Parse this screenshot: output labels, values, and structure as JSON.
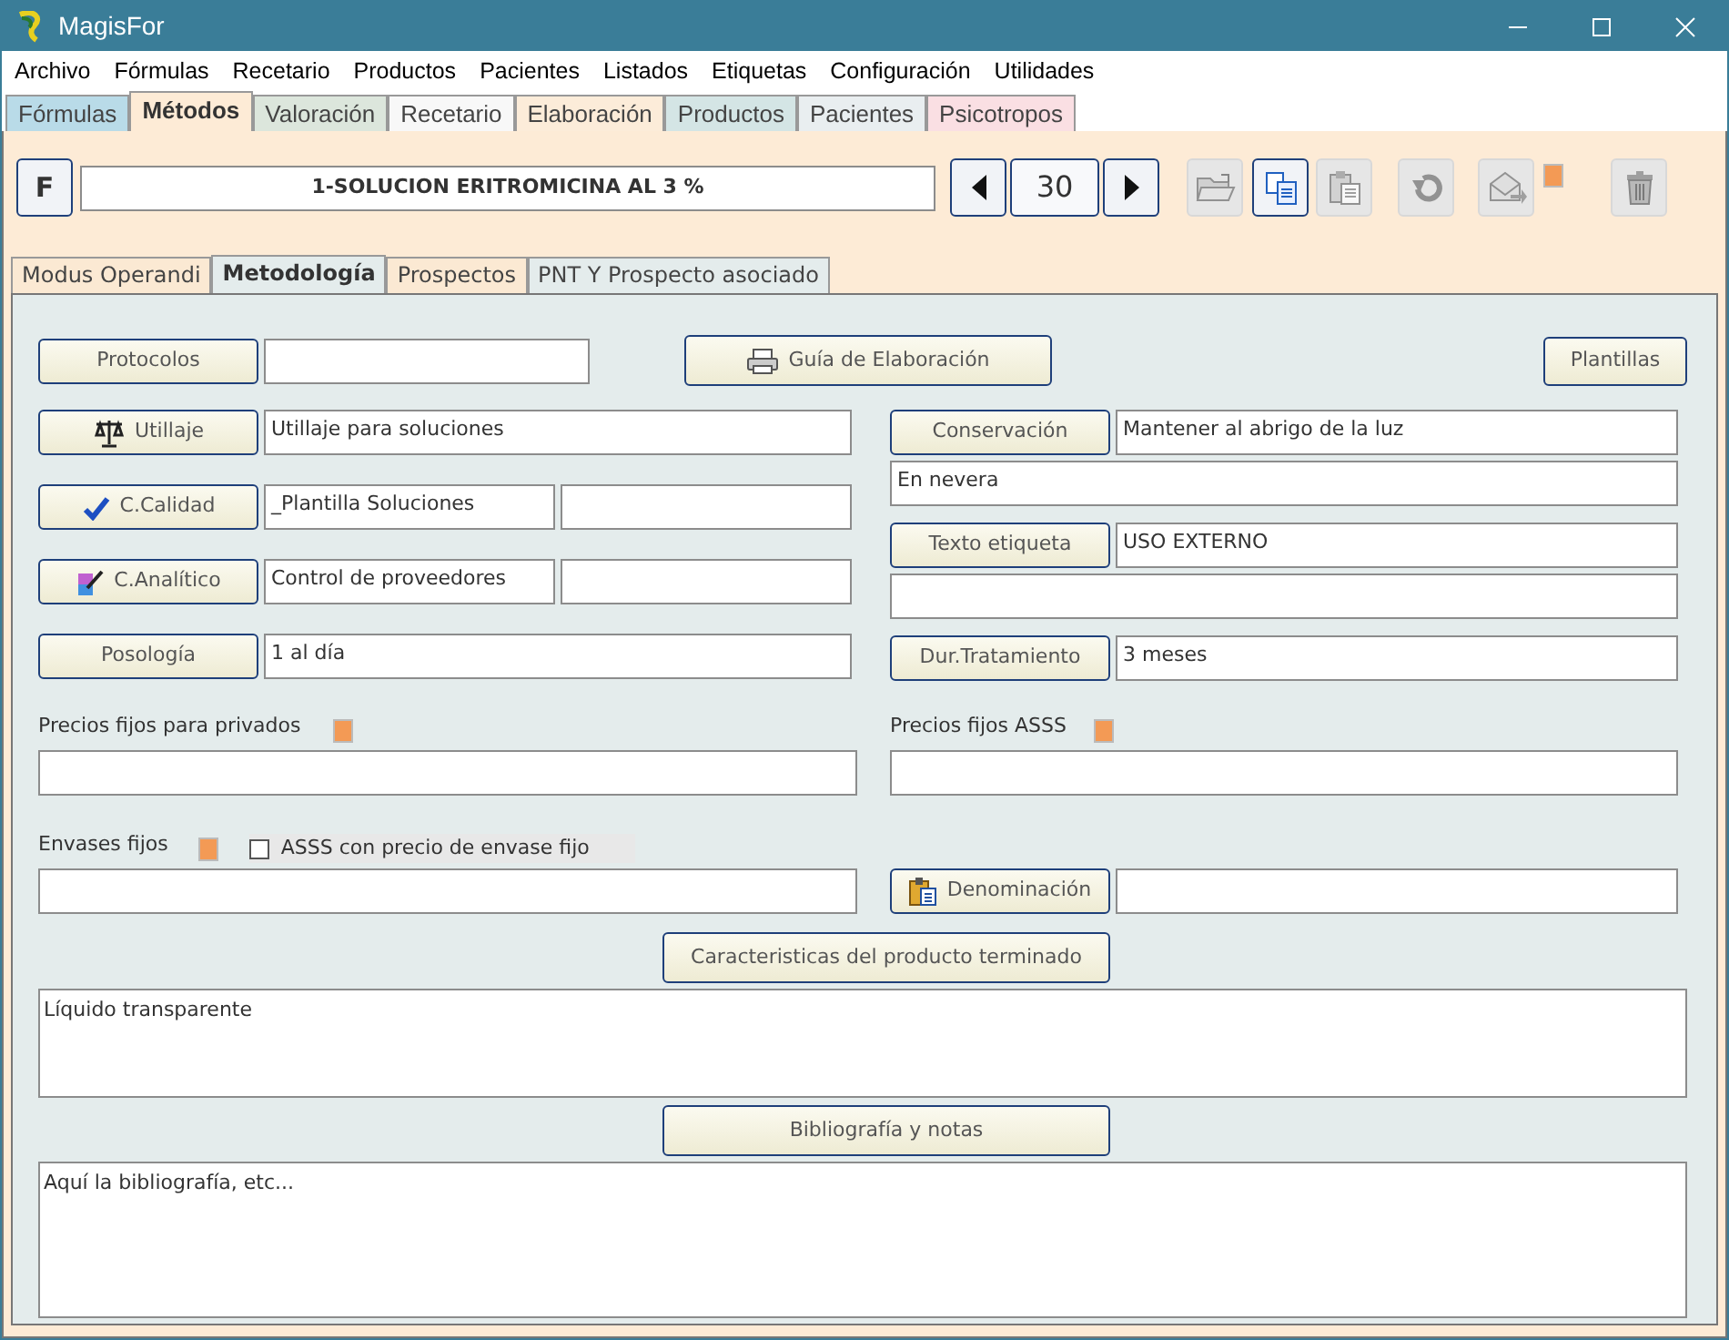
{
  "window": {
    "title": "MagisFor"
  },
  "menu": [
    "Archivo",
    "Fórmulas",
    "Recetario",
    "Productos",
    "Pacientes",
    "Listados",
    "Etiquetas",
    "Configuración",
    "Utilidades"
  ],
  "main_tabs": [
    {
      "label": "Fórmulas",
      "selected": false,
      "color": "#b9dbe8"
    },
    {
      "label": "Métodos",
      "selected": true,
      "color": "#fdebd6"
    },
    {
      "label": "Valoración",
      "selected": false,
      "color": "#dce6dc"
    },
    {
      "label": "Recetario",
      "selected": false,
      "color": "#f8f8f8"
    },
    {
      "label": "Elaboración",
      "selected": false,
      "color": "#fcecd9"
    },
    {
      "label": "Productos",
      "selected": false,
      "color": "#d4e5e5"
    },
    {
      "label": "Pacientes",
      "selected": false,
      "color": "#e9eef0"
    },
    {
      "label": "Psicotropos",
      "selected": false,
      "color": "#fadfe3"
    }
  ],
  "toolbar": {
    "f_button": "F",
    "formula": "1-SOLUCION ERITROMICINA AL 3 %",
    "record": "30",
    "tools": [
      {
        "kind": "open",
        "disabled": true
      },
      {
        "kind": "copy",
        "disabled": false
      },
      {
        "kind": "paste",
        "disabled": true
      },
      {
        "kind": "undo",
        "disabled": true
      },
      {
        "kind": "send",
        "disabled": true,
        "flag": true
      },
      {
        "kind": "delete",
        "disabled": true
      }
    ]
  },
  "sub_tabs": [
    {
      "label": "Modus Operandi",
      "selected": false,
      "color": "#fbe9d3"
    },
    {
      "label": "Metodología",
      "selected": true,
      "color": "#e4ecec"
    },
    {
      "label": "Prospectos",
      "selected": false,
      "color": "#fbe9d3"
    },
    {
      "label": "PNT Y Prospecto asociado",
      "selected": false,
      "color": "#e4ecec"
    }
  ],
  "form": {
    "protocols_button": "Protocolos",
    "guide_button": "Guía de Elaboración",
    "templates_button": "Plantillas",
    "left": [
      {
        "button": "Utillaje",
        "kind": "scale",
        "fields": [
          {
            "kind": "text",
            "value": "Utillaje para soluciones"
          }
        ]
      },
      {
        "button": "C.Calidad",
        "kind": "check",
        "fields": [
          {
            "kind": "text",
            "value": "_Plantilla Soluciones"
          },
          {
            "kind": "empty"
          }
        ]
      },
      {
        "button": "C.Analítico",
        "kind": "pencil",
        "fields": [
          {
            "kind": "text",
            "value": "Control de proveedores"
          },
          {
            "kind": "empty"
          }
        ]
      },
      {
        "button": "Posología",
        "kind": "plain",
        "fields": [
          {
            "kind": "text",
            "value": "1 al día"
          }
        ]
      }
    ],
    "right": [
      {
        "kind": "button-field",
        "button": "Conservación",
        "value": "Mantener al abrigo de la luz"
      },
      {
        "kind": "field",
        "value": "En nevera"
      },
      {
        "kind": "button-field",
        "button": "Texto etiqueta",
        "value": "USO EXTERNO"
      },
      {
        "kind": "field"
      },
      {
        "kind": "button-field",
        "button": "Dur.Tratamiento",
        "value": "3 meses"
      }
    ],
    "prices_private": {
      "label": "Precios fijos para privados",
      "flag": true
    },
    "prices_asss": {
      "label": "Precios fijos ASSS",
      "flag": true
    },
    "fixed_packages": {
      "label": "Envases fijos",
      "flag": true,
      "checkbox": {
        "label": "ASSS con precio de envase fijo",
        "checked": false
      }
    },
    "denomination_button": "Denominación",
    "characteristics": {
      "button": "Caracteristicas del producto terminado",
      "text": "Líquido transparente"
    },
    "bibliography": {
      "button": "Bibliografía y notas",
      "text": "Aquí la bibliografía, etc..."
    }
  }
}
